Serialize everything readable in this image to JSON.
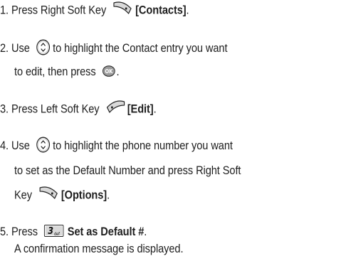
{
  "steps": [
    {
      "number": "1.",
      "before": "Press Right Soft Key",
      "bold": "[Contacts]",
      "after": "."
    },
    {
      "number": "2.",
      "line1_before": "Use",
      "line1_after": "to highlight the Contact entry you want",
      "line2_before": "to edit, then press",
      "line2_after": "."
    },
    {
      "number": "3.",
      "before": "Press Left Soft Key",
      "bold": "[Edit]",
      "after": "."
    },
    {
      "number": "4.",
      "line1_before": "Use",
      "line1_after": "to highlight the phone number you want",
      "line2": "to set as the Default Number and press Right Soft",
      "line3_before": "Key",
      "line3_bold": "[Options]",
      "line3_after": "."
    },
    {
      "number": "5.",
      "before": "Press",
      "bold": "Set as Default #",
      "after": ".",
      "confirmation": "A confirmation message is displayed."
    }
  ],
  "icons": {
    "navigation_key": "navigation-key-icon",
    "ok_key": "ok-key-icon",
    "right_soft_key": "right-soft-key-icon",
    "left_soft_key": "left-soft-key-icon",
    "key_3": "key-3-icon"
  },
  "key_3_label": {
    "number": "3",
    "letters": "def"
  },
  "colors": {
    "text": "#1e1e1e",
    "icon_fill": "#d9d9d9",
    "icon_stroke": "#222222"
  }
}
